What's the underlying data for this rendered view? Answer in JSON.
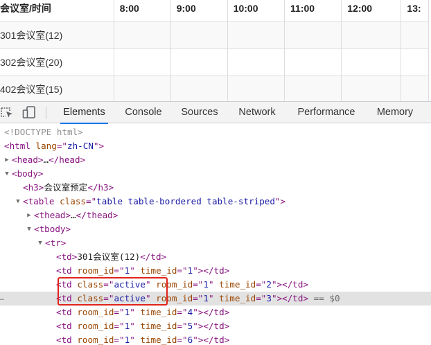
{
  "booking": {
    "header": [
      "会议室/时间",
      "8:00",
      "9:00",
      "10:00",
      "11:00",
      "12:00",
      "13:"
    ],
    "rows": [
      "301会议室(12)",
      "302会议室(20)",
      "402会议室(15)"
    ]
  },
  "devtools": {
    "tabs": [
      "Elements",
      "Console",
      "Sources",
      "Network",
      "Performance",
      "Memory"
    ],
    "active_tab": "Elements",
    "icons": [
      "inspect-element-icon",
      "device-toolbar-icon"
    ],
    "dom_lines": [
      {
        "indent": 0,
        "tri": "",
        "parts": [
          [
            "doctype",
            "<!DOCTYPE html>"
          ]
        ]
      },
      {
        "indent": 0,
        "tri": "",
        "parts": [
          [
            "tag",
            "<html "
          ],
          [
            "attr",
            "lang"
          ],
          [
            "tag",
            "=\""
          ],
          [
            "val",
            "zh-CN"
          ],
          [
            "tag",
            "\">"
          ]
        ]
      },
      {
        "indent": 0,
        "tri": "▶",
        "parts": [
          [
            "tag",
            "<head>"
          ],
          [
            "txt",
            "…"
          ],
          [
            "tag",
            "</head>"
          ]
        ]
      },
      {
        "indent": 0,
        "tri": "▼",
        "parts": [
          [
            "tag",
            "<body>"
          ]
        ]
      },
      {
        "indent": 1,
        "tri": "",
        "parts": [
          [
            "tag",
            "<h3>"
          ],
          [
            "txt",
            "会议室预定"
          ],
          [
            "tag",
            "</h3>"
          ]
        ]
      },
      {
        "indent": 1,
        "tri": "▼",
        "parts": [
          [
            "tag",
            "<table "
          ],
          [
            "attr",
            "class"
          ],
          [
            "tag",
            "=\""
          ],
          [
            "val",
            "table table-bordered table-striped"
          ],
          [
            "tag",
            "\">"
          ]
        ]
      },
      {
        "indent": 2,
        "tri": "▶",
        "parts": [
          [
            "tag",
            "<thead>"
          ],
          [
            "txt",
            "…"
          ],
          [
            "tag",
            "</thead>"
          ]
        ]
      },
      {
        "indent": 2,
        "tri": "▼",
        "parts": [
          [
            "tag",
            "<tbody>"
          ]
        ]
      },
      {
        "indent": 3,
        "tri": "▼",
        "parts": [
          [
            "tag",
            "<tr>"
          ]
        ]
      },
      {
        "indent": 4,
        "tri": "",
        "parts": [
          [
            "tag",
            "<td>"
          ],
          [
            "txt",
            "301会议室(12)"
          ],
          [
            "tag",
            "</td>"
          ]
        ]
      },
      {
        "indent": 4,
        "tri": "",
        "parts": [
          [
            "tag",
            "<td "
          ],
          [
            "attr",
            "room_id"
          ],
          [
            "tag",
            "=\""
          ],
          [
            "val",
            "1"
          ],
          [
            "tag",
            "\" "
          ],
          [
            "attr",
            "time_id"
          ],
          [
            "tag",
            "=\""
          ],
          [
            "val",
            "1"
          ],
          [
            "tag",
            "\"></td>"
          ]
        ]
      },
      {
        "indent": 4,
        "tri": "",
        "parts": [
          [
            "tag",
            "<td "
          ],
          [
            "attr",
            "class"
          ],
          [
            "tag",
            "=\""
          ],
          [
            "val",
            "active"
          ],
          [
            "tag",
            "\" "
          ],
          [
            "attr",
            "room_id"
          ],
          [
            "tag",
            "=\""
          ],
          [
            "val",
            "1"
          ],
          [
            "tag",
            "\" "
          ],
          [
            "attr",
            "time_id"
          ],
          [
            "tag",
            "=\""
          ],
          [
            "val",
            "2"
          ],
          [
            "tag",
            "\"></td>"
          ]
        ]
      },
      {
        "indent": 4,
        "tri": "",
        "selected": true,
        "parts": [
          [
            "tag",
            "<td "
          ],
          [
            "attr",
            "class"
          ],
          [
            "tag",
            "=\""
          ],
          [
            "val",
            "active"
          ],
          [
            "tag",
            "\" "
          ],
          [
            "attr",
            "room_id"
          ],
          [
            "tag",
            "=\""
          ],
          [
            "val",
            "1"
          ],
          [
            "tag",
            "\" "
          ],
          [
            "attr",
            "time_id"
          ],
          [
            "tag",
            "=\""
          ],
          [
            "val",
            "3"
          ],
          [
            "tag",
            "\"></td>"
          ],
          [
            "eq0",
            " == $0"
          ]
        ]
      },
      {
        "indent": 4,
        "tri": "",
        "parts": [
          [
            "tag",
            "<td "
          ],
          [
            "attr",
            "room_id"
          ],
          [
            "tag",
            "=\""
          ],
          [
            "val",
            "1"
          ],
          [
            "tag",
            "\" "
          ],
          [
            "attr",
            "time_id"
          ],
          [
            "tag",
            "=\""
          ],
          [
            "val",
            "4"
          ],
          [
            "tag",
            "\"></td>"
          ]
        ]
      },
      {
        "indent": 4,
        "tri": "",
        "parts": [
          [
            "tag",
            "<td "
          ],
          [
            "attr",
            "room_id"
          ],
          [
            "tag",
            "=\""
          ],
          [
            "val",
            "1"
          ],
          [
            "tag",
            "\" "
          ],
          [
            "attr",
            "time_id"
          ],
          [
            "tag",
            "=\""
          ],
          [
            "val",
            "5"
          ],
          [
            "tag",
            "\"></td>"
          ]
        ]
      },
      {
        "indent": 4,
        "tri": "",
        "parts": [
          [
            "tag",
            "<td "
          ],
          [
            "attr",
            "room_id"
          ],
          [
            "tag",
            "=\""
          ],
          [
            "val",
            "1"
          ],
          [
            "tag",
            "\" "
          ],
          [
            "attr",
            "time_id"
          ],
          [
            "tag",
            "=\""
          ],
          [
            "val",
            "6"
          ],
          [
            "tag",
            "\"></td>"
          ]
        ]
      }
    ],
    "colors": {
      "tag": "#881280",
      "attr": "#994500",
      "value": "#1a1aa6",
      "highlight_box": "#e0231b",
      "active_tab_underline": "#1a73e8"
    }
  }
}
